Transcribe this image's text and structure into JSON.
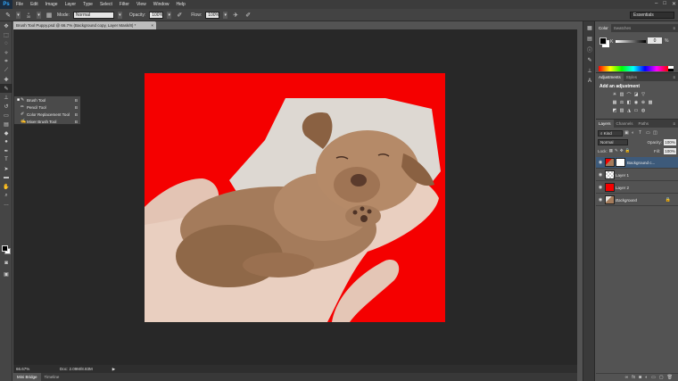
{
  "menubar": {
    "logo": "Ps",
    "items": [
      "File",
      "Edit",
      "Image",
      "Layer",
      "Type",
      "Select",
      "Filter",
      "View",
      "Window",
      "Help"
    ],
    "window_controls": [
      "–",
      "□",
      "✕"
    ]
  },
  "options_bar": {
    "brush_size": "30",
    "mode_label": "Mode:",
    "mode_value": "Normal",
    "opacity_label": "Opacity:",
    "opacity_value": "100%",
    "flow_label": "Flow:",
    "flow_value": "100%",
    "workspace": "Essentials"
  },
  "document": {
    "tab_title": "Brush Tool Puppy.psd @ 66.7% (Background copy, Layer Mask/8) *",
    "tab_close": "×",
    "zoom": "66.67%",
    "doc_size": "Doc: 2.09M/8.83M"
  },
  "flyout": {
    "items": [
      {
        "label": "Brush Tool",
        "key": "B",
        "selected": true
      },
      {
        "label": "Pencil Tool",
        "key": "B",
        "selected": false
      },
      {
        "label": "Color Replacement Tool",
        "key": "B",
        "selected": false
      },
      {
        "label": "Mixer Brush Tool",
        "key": "B",
        "selected": false
      }
    ]
  },
  "bottom_tabs": [
    "Mini Bridge",
    "Timeline"
  ],
  "color_panel": {
    "tabs": [
      "Color",
      "Swatches"
    ],
    "k_label": "K",
    "k_value": "0",
    "pct": "%"
  },
  "adjustments_panel": {
    "tabs": [
      "Adjustments",
      "Styles"
    ],
    "title": "Add an adjustment"
  },
  "layers_panel": {
    "tabs": [
      "Layers",
      "Channels",
      "Paths"
    ],
    "kind": "Kind",
    "blend_mode": "Normal",
    "opacity_label": "Opacity:",
    "opacity_value": "100%",
    "lock_label": "Lock:",
    "fill_label": "Fill:",
    "fill_value": "100%",
    "layers": [
      {
        "name": "Background c...",
        "selected": true,
        "thumb": "photo",
        "mask": true,
        "locked": false
      },
      {
        "name": "Layer 1",
        "selected": false,
        "thumb": "transparent",
        "mask": false,
        "locked": false
      },
      {
        "name": "Layer 2",
        "selected": false,
        "thumb": "red",
        "mask": false,
        "locked": false
      },
      {
        "name": "Background",
        "selected": false,
        "thumb": "photo",
        "mask": false,
        "locked": true
      }
    ]
  },
  "colors": {
    "canvas_red": "#f50000",
    "selected_layer": "#3d5a7a",
    "doc_bg": "#282828"
  }
}
